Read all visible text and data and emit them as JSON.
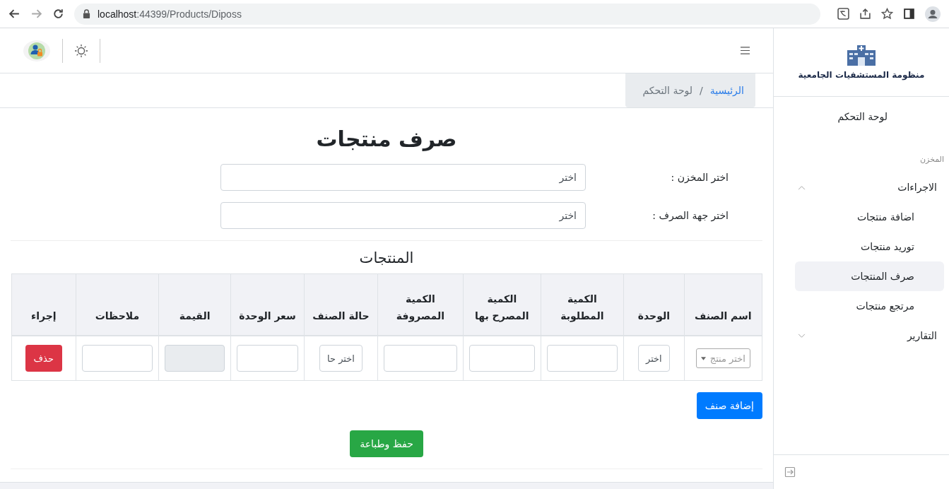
{
  "browser": {
    "url_host": "localhost",
    "url_rest": ":44399/Products/Diposs"
  },
  "breadcrumb": [
    {
      "label": "الرئيسية",
      "kind": "link"
    },
    {
      "label": "لوحة التحكم",
      "kind": "current"
    }
  ],
  "breadcrumb_separator": "/",
  "sidebar": {
    "brand": "منظومة المستشفيات الجامعية",
    "items": [
      {
        "kind": "link",
        "label": "لوحة التحكم"
      },
      {
        "kind": "section",
        "label": "المخزن"
      },
      {
        "kind": "group",
        "label": "الاجراءات",
        "expanded": true,
        "children": [
          {
            "label": "اضافة منتجات",
            "selected": false
          },
          {
            "label": "توريد منتجات",
            "selected": false
          },
          {
            "label": "صرف المنتجات",
            "selected": true
          },
          {
            "label": "مرتجع منتجات",
            "selected": false
          }
        ]
      },
      {
        "kind": "group",
        "label": "التقارير",
        "expanded": false
      }
    ]
  },
  "page_title": "صرف منتجات",
  "form": [
    {
      "label": "اختر المخزن :",
      "value": "اختر"
    },
    {
      "label": "اختر جهة الصرف :",
      "value": "اختر"
    }
  ],
  "table": {
    "title": "المنتجات",
    "columns": [
      "اسم الصنف",
      "الوحدة",
      "الكمية المطلوبة",
      "الكمية المصرح بها",
      "الكمية المصروفة",
      "حالة الصنف",
      "سعر الوحدة",
      "القيمة",
      "ملاحظات",
      "إجراء"
    ],
    "rows": [
      {
        "cells": [
          {
            "kind": "select",
            "placeholder": "اختر منتج"
          },
          {
            "kind": "choice",
            "value": "اختر"
          },
          {
            "kind": "input"
          },
          {
            "kind": "input"
          },
          {
            "kind": "input"
          },
          {
            "kind": "choice",
            "value": "اختر حا"
          },
          {
            "kind": "input"
          },
          {
            "kind": "readonly"
          },
          {
            "kind": "input"
          },
          {
            "kind": "button",
            "label": "حذف"
          }
        ]
      }
    ]
  },
  "add_button": "إضافة صنف",
  "save_button": "حفظ وطباعة"
}
